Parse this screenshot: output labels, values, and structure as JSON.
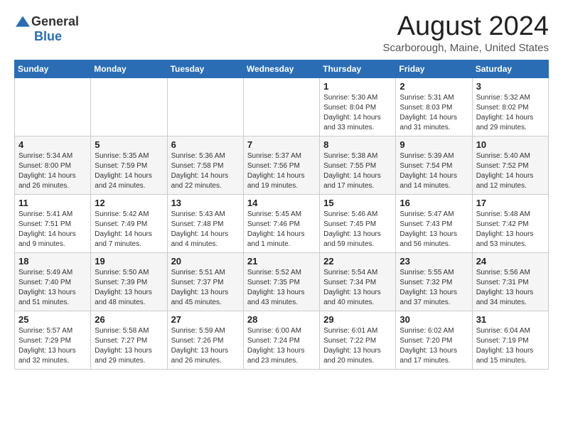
{
  "header": {
    "logo_general": "General",
    "logo_blue": "Blue",
    "month_title": "August 2024",
    "location": "Scarborough, Maine, United States"
  },
  "weekdays": [
    "Sunday",
    "Monday",
    "Tuesday",
    "Wednesday",
    "Thursday",
    "Friday",
    "Saturday"
  ],
  "weeks": [
    [
      {
        "day": "",
        "info": ""
      },
      {
        "day": "",
        "info": ""
      },
      {
        "day": "",
        "info": ""
      },
      {
        "day": "",
        "info": ""
      },
      {
        "day": "1",
        "info": "Sunrise: 5:30 AM\nSunset: 8:04 PM\nDaylight: 14 hours\nand 33 minutes."
      },
      {
        "day": "2",
        "info": "Sunrise: 5:31 AM\nSunset: 8:03 PM\nDaylight: 14 hours\nand 31 minutes."
      },
      {
        "day": "3",
        "info": "Sunrise: 5:32 AM\nSunset: 8:02 PM\nDaylight: 14 hours\nand 29 minutes."
      }
    ],
    [
      {
        "day": "4",
        "info": "Sunrise: 5:34 AM\nSunset: 8:00 PM\nDaylight: 14 hours\nand 26 minutes."
      },
      {
        "day": "5",
        "info": "Sunrise: 5:35 AM\nSunset: 7:59 PM\nDaylight: 14 hours\nand 24 minutes."
      },
      {
        "day": "6",
        "info": "Sunrise: 5:36 AM\nSunset: 7:58 PM\nDaylight: 14 hours\nand 22 minutes."
      },
      {
        "day": "7",
        "info": "Sunrise: 5:37 AM\nSunset: 7:56 PM\nDaylight: 14 hours\nand 19 minutes."
      },
      {
        "day": "8",
        "info": "Sunrise: 5:38 AM\nSunset: 7:55 PM\nDaylight: 14 hours\nand 17 minutes."
      },
      {
        "day": "9",
        "info": "Sunrise: 5:39 AM\nSunset: 7:54 PM\nDaylight: 14 hours\nand 14 minutes."
      },
      {
        "day": "10",
        "info": "Sunrise: 5:40 AM\nSunset: 7:52 PM\nDaylight: 14 hours\nand 12 minutes."
      }
    ],
    [
      {
        "day": "11",
        "info": "Sunrise: 5:41 AM\nSunset: 7:51 PM\nDaylight: 14 hours\nand 9 minutes."
      },
      {
        "day": "12",
        "info": "Sunrise: 5:42 AM\nSunset: 7:49 PM\nDaylight: 14 hours\nand 7 minutes."
      },
      {
        "day": "13",
        "info": "Sunrise: 5:43 AM\nSunset: 7:48 PM\nDaylight: 14 hours\nand 4 minutes."
      },
      {
        "day": "14",
        "info": "Sunrise: 5:45 AM\nSunset: 7:46 PM\nDaylight: 14 hours\nand 1 minute."
      },
      {
        "day": "15",
        "info": "Sunrise: 5:46 AM\nSunset: 7:45 PM\nDaylight: 13 hours\nand 59 minutes."
      },
      {
        "day": "16",
        "info": "Sunrise: 5:47 AM\nSunset: 7:43 PM\nDaylight: 13 hours\nand 56 minutes."
      },
      {
        "day": "17",
        "info": "Sunrise: 5:48 AM\nSunset: 7:42 PM\nDaylight: 13 hours\nand 53 minutes."
      }
    ],
    [
      {
        "day": "18",
        "info": "Sunrise: 5:49 AM\nSunset: 7:40 PM\nDaylight: 13 hours\nand 51 minutes."
      },
      {
        "day": "19",
        "info": "Sunrise: 5:50 AM\nSunset: 7:39 PM\nDaylight: 13 hours\nand 48 minutes."
      },
      {
        "day": "20",
        "info": "Sunrise: 5:51 AM\nSunset: 7:37 PM\nDaylight: 13 hours\nand 45 minutes."
      },
      {
        "day": "21",
        "info": "Sunrise: 5:52 AM\nSunset: 7:35 PM\nDaylight: 13 hours\nand 43 minutes."
      },
      {
        "day": "22",
        "info": "Sunrise: 5:54 AM\nSunset: 7:34 PM\nDaylight: 13 hours\nand 40 minutes."
      },
      {
        "day": "23",
        "info": "Sunrise: 5:55 AM\nSunset: 7:32 PM\nDaylight: 13 hours\nand 37 minutes."
      },
      {
        "day": "24",
        "info": "Sunrise: 5:56 AM\nSunset: 7:31 PM\nDaylight: 13 hours\nand 34 minutes."
      }
    ],
    [
      {
        "day": "25",
        "info": "Sunrise: 5:57 AM\nSunset: 7:29 PM\nDaylight: 13 hours\nand 32 minutes."
      },
      {
        "day": "26",
        "info": "Sunrise: 5:58 AM\nSunset: 7:27 PM\nDaylight: 13 hours\nand 29 minutes."
      },
      {
        "day": "27",
        "info": "Sunrise: 5:59 AM\nSunset: 7:26 PM\nDaylight: 13 hours\nand 26 minutes."
      },
      {
        "day": "28",
        "info": "Sunrise: 6:00 AM\nSunset: 7:24 PM\nDaylight: 13 hours\nand 23 minutes."
      },
      {
        "day": "29",
        "info": "Sunrise: 6:01 AM\nSunset: 7:22 PM\nDaylight: 13 hours\nand 20 minutes."
      },
      {
        "day": "30",
        "info": "Sunrise: 6:02 AM\nSunset: 7:20 PM\nDaylight: 13 hours\nand 17 minutes."
      },
      {
        "day": "31",
        "info": "Sunrise: 6:04 AM\nSunset: 7:19 PM\nDaylight: 13 hours\nand 15 minutes."
      }
    ]
  ]
}
